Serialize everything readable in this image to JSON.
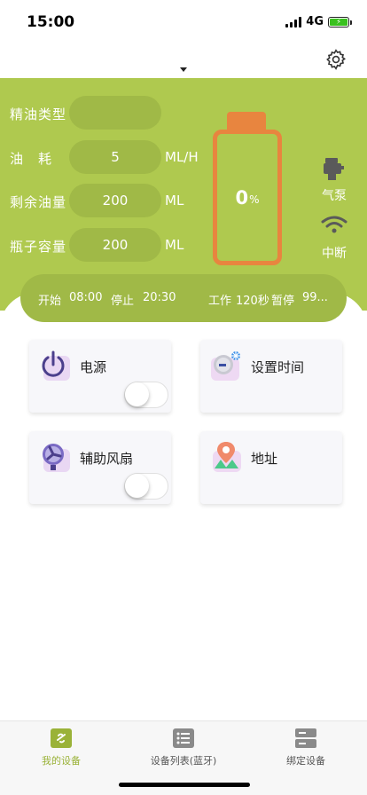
{
  "status": {
    "time": "15:00",
    "network": "4G"
  },
  "panel": {
    "rows": [
      {
        "label": "精油类型",
        "value": "",
        "unit": ""
      },
      {
        "label": "油　耗",
        "value": "5",
        "unit": "ML/H"
      },
      {
        "label": "剩余油量",
        "value": "200",
        "unit": "ML"
      },
      {
        "label": "瓶子容量",
        "value": "200",
        "unit": "ML"
      }
    ],
    "tank": {
      "level": "0",
      "unit": "%"
    },
    "pump_label": "气泵",
    "connection_label": "中断"
  },
  "schedule": {
    "start_label": "开始",
    "start_time": "08:00",
    "stop_label": "停止",
    "stop_time": "20:30",
    "work_label": "工作",
    "work_value": "120秒",
    "pause_label": "暂停",
    "pause_value": "99..."
  },
  "cards": {
    "power": {
      "title": "电源",
      "on": false
    },
    "timer": {
      "title": "设置时间"
    },
    "fan": {
      "title": "辅助风扇",
      "on": false
    },
    "address": {
      "title": "地址"
    }
  },
  "tabs": [
    {
      "label": "我的设备",
      "active": true
    },
    {
      "label": "设备列表(蓝牙)",
      "active": false
    },
    {
      "label": "绑定设备",
      "active": false
    }
  ],
  "colors": {
    "panel_green": "#afc94f",
    "pill_green": "#a0b947",
    "tank_orange": "#e8853f",
    "tab_active": "#9ab238"
  }
}
